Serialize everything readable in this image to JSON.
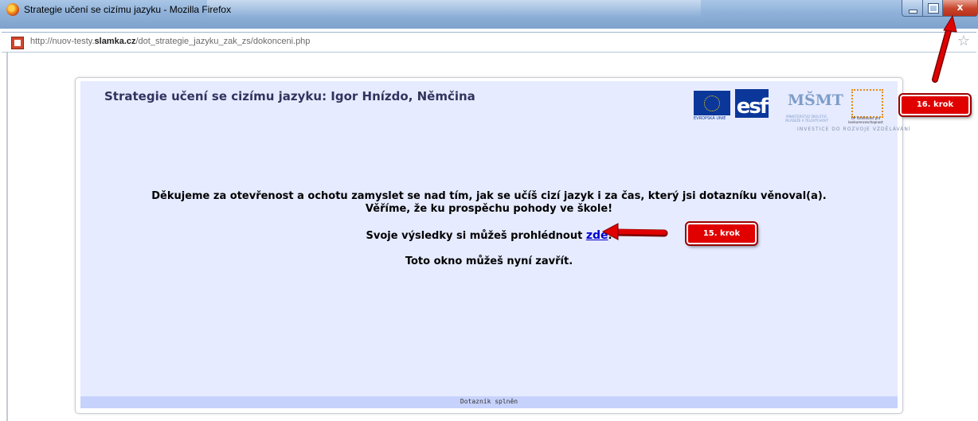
{
  "window": {
    "title": "Strategie učení se cizímu jazyku - Mozilla Firefox",
    "close_glyph": "x"
  },
  "address_bar": {
    "url_prefix": "http://nuov-testy.",
    "url_domain": "slamka.cz",
    "url_path": "/dot_strategie_jazyku_zak_zs/dokonceni.php",
    "star_glyph": "☆"
  },
  "page": {
    "title": "Strategie učení se cizímu jazyku: Igor Hnízdo, Němčina",
    "logos": {
      "eu_text": "EVROPSKÁ UNIE",
      "esf_text": "esf",
      "msmt_text": "MŠMT",
      "msmt_caption": "MINISTERSTVO ŠKOLSTVÍ, MLÁDEŽE A TĚLOVÝCHOVY",
      "op_caption": "OP Vzdělávání pro konkurenceschopnost",
      "investice": "INVESTICE DO ROZVOJE VZDĚLÁVÁNÍ"
    },
    "thanks_line1": "Děkujeme za otevřenost a ochotu zamyslet se nad tím, jak se učíš cizí jazyk i za čas, který jsi dotazníku věnoval(a).",
    "thanks_line2": "Věříme, že ku prospěchu pohody ve škole!",
    "results_prefix": "Svoje výsledky si můžeš prohlédnout ",
    "results_link": "zde",
    "results_suffix": ".",
    "close_hint": "Toto okno můžeš nyní zavřít.",
    "footer": "Dotazník splněn"
  },
  "annotations": {
    "step15": "15. krok",
    "step16": "16. krok",
    "arrow_color": "#e00000"
  }
}
